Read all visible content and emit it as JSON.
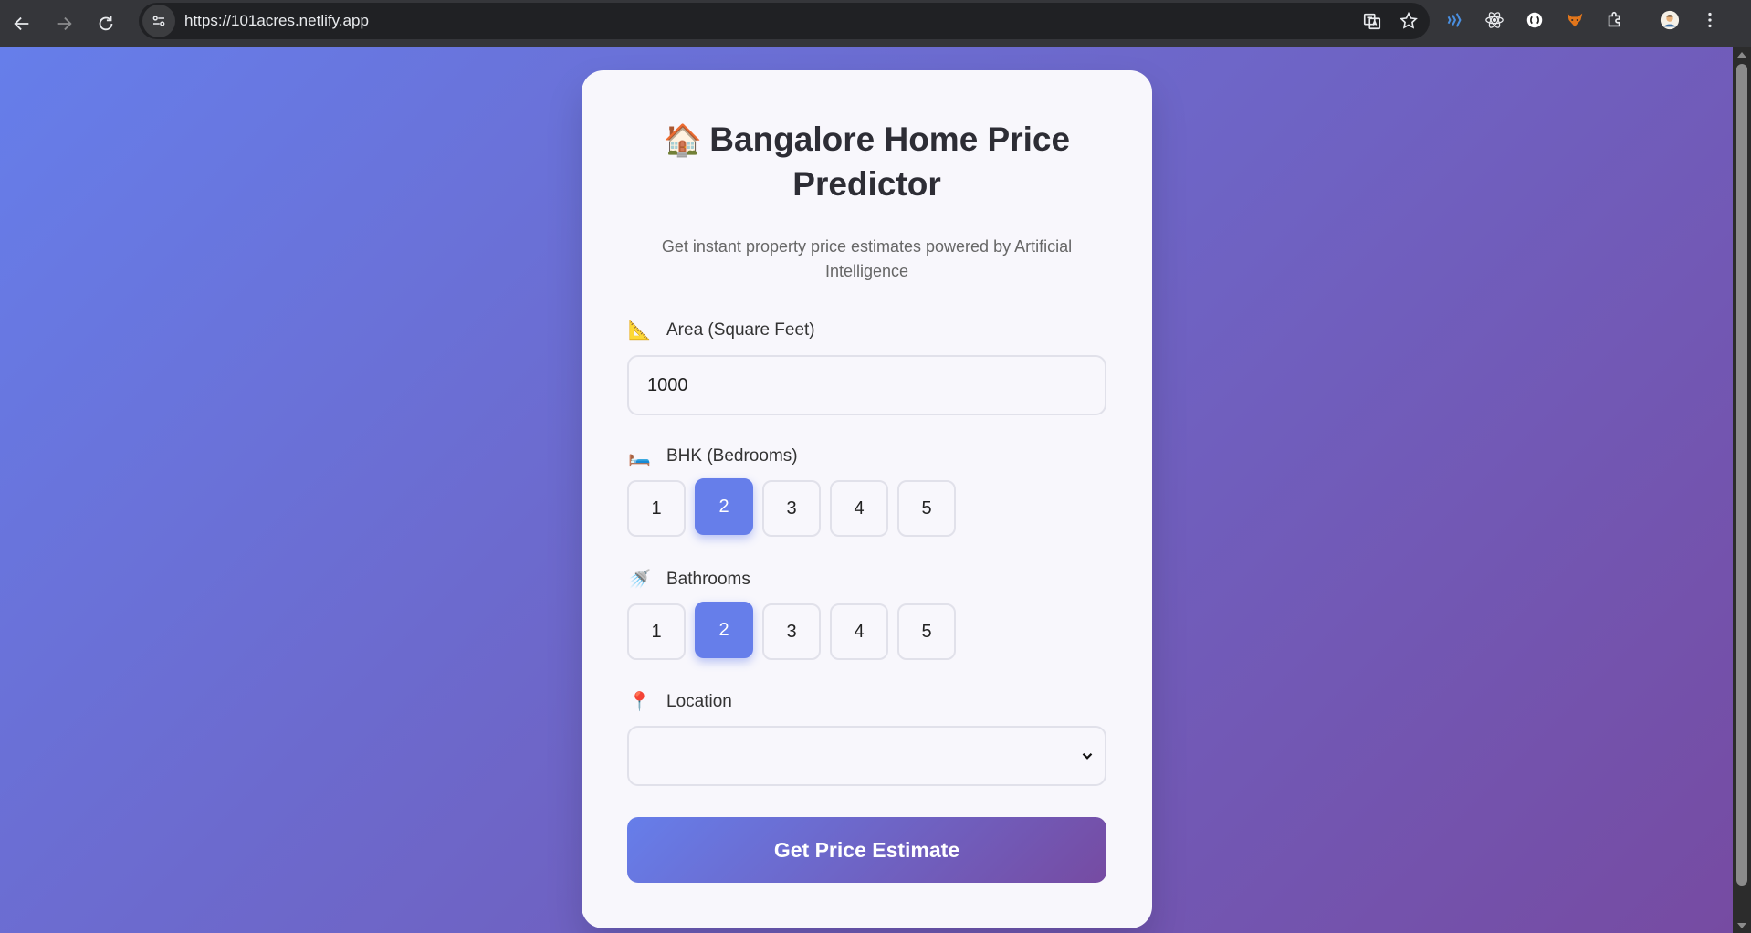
{
  "browser": {
    "url": "https://101acres.netlify.app",
    "icons": [
      "back-arrow-icon",
      "forward-arrow-icon",
      "reload-icon",
      "site-info-icon",
      "translate-icon",
      "bookmark-star-icon",
      "extension-icons",
      "profile-avatar",
      "menu-icon"
    ]
  },
  "app": {
    "title_emoji": "🏠",
    "title": "Bangalore Home Price Predictor",
    "subtitle": "Get instant property price estimates powered by Artificial Intelligence",
    "area": {
      "emoji": "📐",
      "label": "Area (Square Feet)",
      "value": "1000"
    },
    "bhk": {
      "emoji": "🛏️",
      "label": "BHK (Bedrooms)",
      "options": [
        "1",
        "2",
        "3",
        "4",
        "5"
      ],
      "selected": "2"
    },
    "bath": {
      "emoji": "🚿",
      "label": "Bathrooms",
      "options": [
        "1",
        "2",
        "3",
        "4",
        "5"
      ],
      "selected": "2"
    },
    "location": {
      "emoji": "📍",
      "label": "Location",
      "value": ""
    },
    "submit_label": "Get Price Estimate"
  },
  "colors": {
    "gradient_start": "#667eea",
    "gradient_end": "#764ba2",
    "selected_option": "#667eea"
  }
}
